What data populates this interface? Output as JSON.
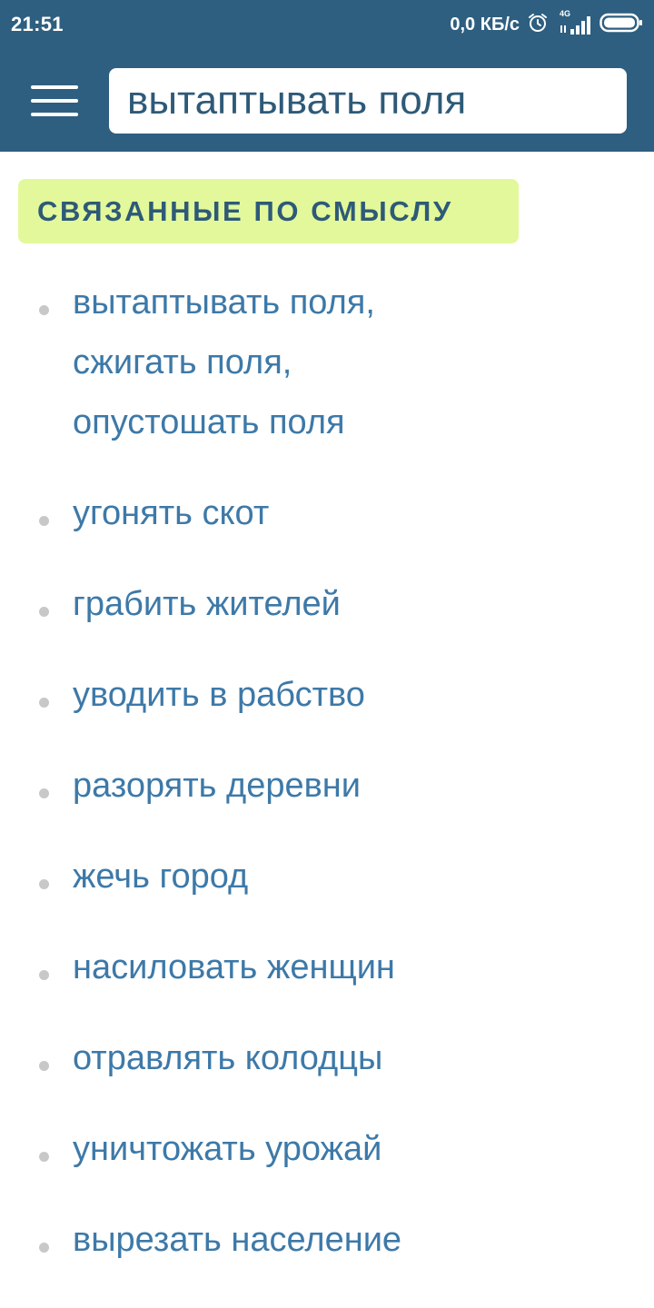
{
  "status_bar": {
    "time": "21:51",
    "network_speed": "0,0 КБ/с",
    "network_type": "4G",
    "icons": [
      "alarm-icon",
      "signal-icon",
      "battery-icon"
    ]
  },
  "app_bar": {
    "menu_icon": "hamburger-menu-icon",
    "search_value": "вытаптывать поля"
  },
  "section": {
    "title": "СВЯЗАННЫЕ ПО СМЫСЛУ"
  },
  "results": {
    "group": [
      "вытаптывать поля,",
      "сжигать поля,",
      "опустошать поля"
    ],
    "items": [
      "угонять скот",
      "грабить жителей",
      "уводить в рабство",
      "разорять деревни",
      "жечь город",
      "насиловать женщин",
      "отравлять колодцы",
      "уничтожать урожай",
      "вырезать население"
    ]
  },
  "colors": {
    "header_bg": "#2e5f80",
    "badge_bg": "#e3f89a",
    "badge_text": "#2e5a78",
    "link": "#3d79a8",
    "bullet": "#c8c8c8"
  }
}
